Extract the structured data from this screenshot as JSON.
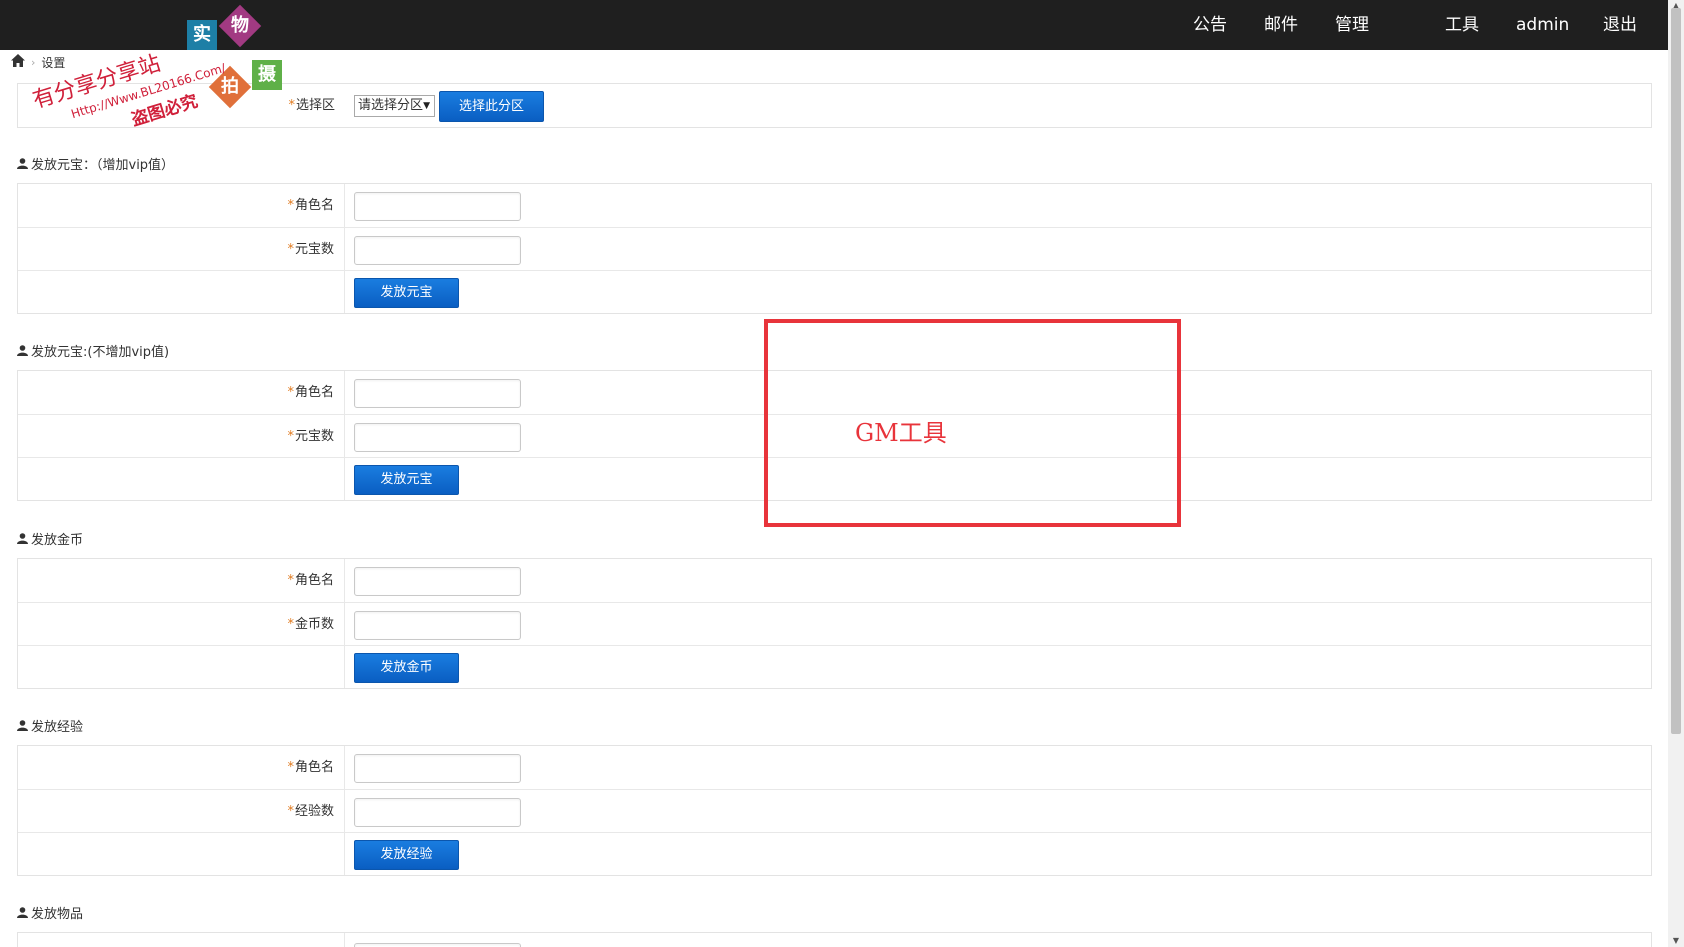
{
  "nav": {
    "items": [
      "公告",
      "邮件",
      "管理",
      "工具",
      "admin",
      "退出"
    ]
  },
  "breadcrumb": {
    "current": "设置"
  },
  "zone": {
    "label": "选择区",
    "select_value": "请选择分区",
    "button": "选择此分区"
  },
  "sections": [
    {
      "title": "发放元宝：（增加vip值）",
      "fields": [
        "角色名",
        "元宝数"
      ],
      "button": "发放元宝"
    },
    {
      "title": "发放元宝:(不增加vip值)",
      "fields": [
        "角色名",
        "元宝数"
      ],
      "button": "发放元宝"
    },
    {
      "title": "发放金币",
      "fields": [
        "角色名",
        "金币数"
      ],
      "button": "发放金币"
    },
    {
      "title": "发放经验",
      "fields": [
        "角色名",
        "经验数"
      ],
      "button": "发放经验"
    },
    {
      "title": "发放物品"
    }
  ],
  "annotation": {
    "label": "GM工具",
    "color": "#e8343b"
  },
  "watermark": {
    "badges": [
      "实",
      "物",
      "拍",
      "摄"
    ],
    "line1": "有分享分享站",
    "line2": "Http://Www.BL20166.Com/",
    "line3": "盗图必究"
  },
  "required_mark": "*",
  "colors": {
    "navbar": "#1f1f1f",
    "button": "#0a6ad3",
    "required": "#e07a1f"
  }
}
